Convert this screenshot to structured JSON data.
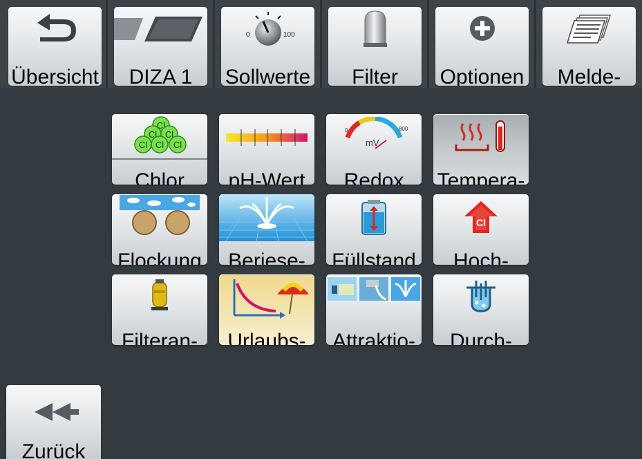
{
  "top_nav": [
    {
      "label": "Übersicht",
      "icon": "back-arrow-icon"
    },
    {
      "label": "DIZA 1",
      "icon": "tilted-panels-icon"
    },
    {
      "label": "Sollwerte",
      "icon": "dial-knob-icon",
      "dial_min": "0",
      "dial_max": "100"
    },
    {
      "label": "Filter",
      "icon": "filter-vessel-icon"
    },
    {
      "label": "Optionen",
      "icon": "plus-circle-icon"
    },
    {
      "label": "Melde-",
      "icon": "documents-stack-icon"
    }
  ],
  "grid": [
    [
      {
        "label": "Chlor",
        "icon": "chlorine-molecules-icon",
        "icon_text": "Cl"
      },
      {
        "label": "pH-Wert",
        "icon": "ph-scale-icon"
      },
      {
        "label": "Redox",
        "icon": "redox-gauge-icon",
        "gauge_unit": "mV",
        "gauge_min": "0",
        "gauge_max": "800"
      },
      {
        "label": "Tempera-",
        "icon": "heater-thermometer-icon"
      }
    ],
    [
      {
        "label": "Flockung",
        "icon": "flocculation-icon"
      },
      {
        "label": "Beriese-",
        "icon": "fountain-icon"
      },
      {
        "label": "Füllstand",
        "icon": "level-tank-icon"
      },
      {
        "label": "Hoch-",
        "icon": "chlorine-boost-icon",
        "icon_text": "Cl"
      }
    ],
    [
      {
        "label": "Filteran-",
        "icon": "filter-unit-icon"
      },
      {
        "label": "Urlaubs-",
        "icon": "holiday-curve-icon"
      },
      {
        "label": "Attraktio-",
        "icon": "attractions-icon"
      },
      {
        "label": "Durch-",
        "icon": "flow-cell-icon"
      }
    ]
  ],
  "back_button": {
    "label": "Zurück",
    "icon": "double-arrow-left-icon"
  },
  "colors": {
    "background": "#333a40",
    "topbar": "#3d4449",
    "button_top": "#f6f7f8",
    "button_bottom": "#c9cdd0"
  }
}
